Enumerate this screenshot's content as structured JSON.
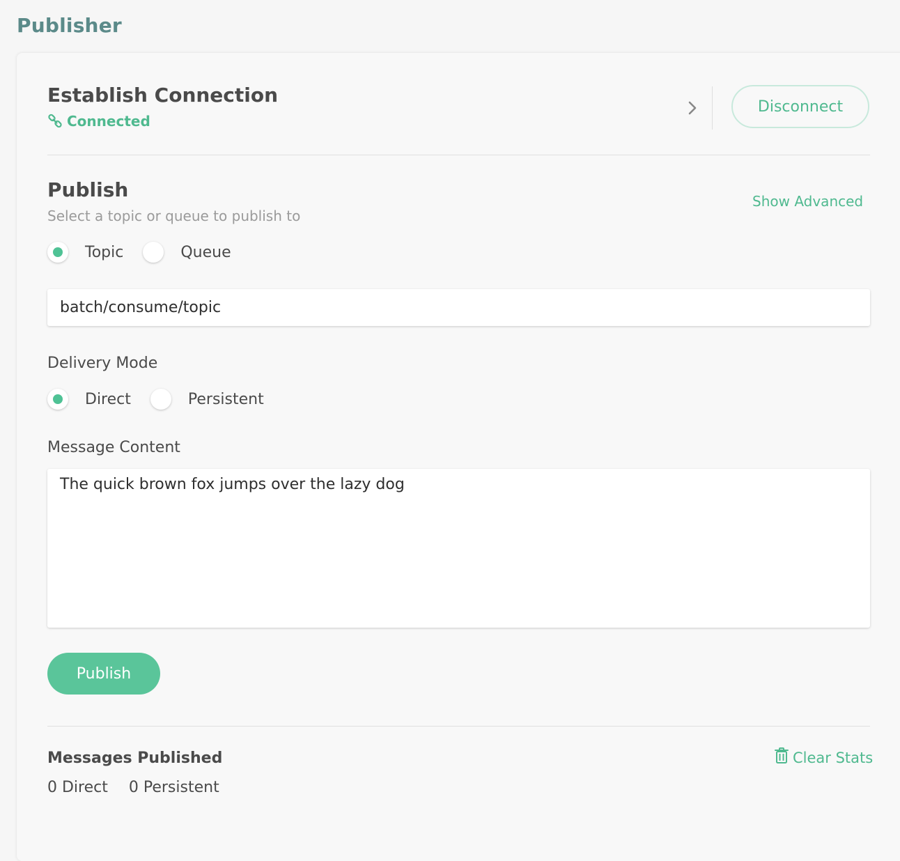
{
  "page": {
    "title": "Publisher"
  },
  "connection": {
    "heading": "Establish Connection",
    "status": "Connected",
    "disconnect_label": "Disconnect"
  },
  "publish": {
    "heading": "Publish",
    "subtitle": "Select a topic or queue to publish to",
    "show_advanced": "Show Advanced",
    "destination_options": [
      {
        "label": "Topic",
        "selected": true
      },
      {
        "label": "Queue",
        "selected": false
      }
    ],
    "destination_value": "batch/consume/topic",
    "delivery_mode_label": "Delivery Mode",
    "delivery_options": [
      {
        "label": "Direct",
        "selected": true
      },
      {
        "label": "Persistent",
        "selected": false
      }
    ],
    "message_label": "Message Content",
    "message_value": "The quick brown fox jumps over the lazy dog",
    "publish_button": "Publish"
  },
  "stats": {
    "heading": "Messages Published",
    "direct": "0 Direct",
    "persistent": "0 Persistent",
    "clear_label": "Clear Stats"
  },
  "colors": {
    "accent": "#4fb98f",
    "title": "#5b8a89",
    "publish_button": "#5ac59a"
  }
}
